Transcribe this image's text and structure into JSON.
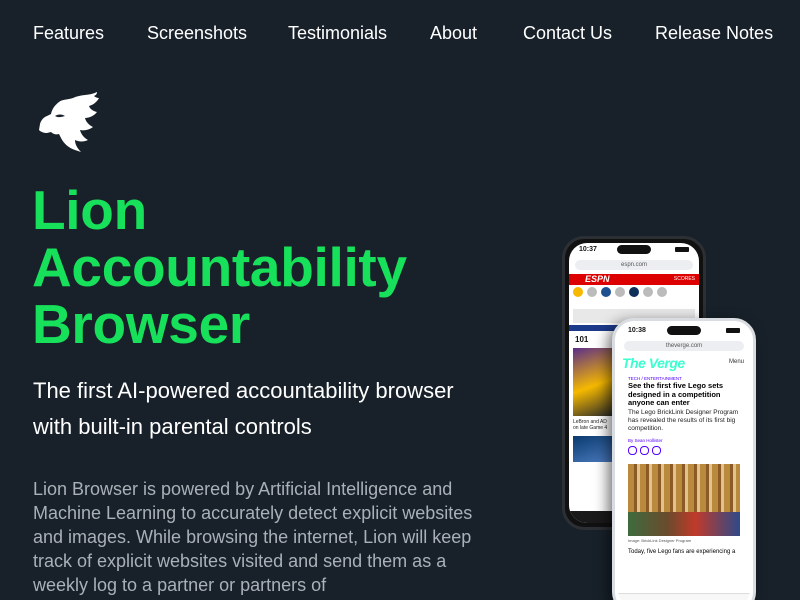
{
  "nav": {
    "items": [
      {
        "label": "Features"
      },
      {
        "label": "Screenshots"
      },
      {
        "label": "Testimonials"
      },
      {
        "label": "About"
      },
      {
        "label": "Contact Us"
      },
      {
        "label": "Release Notes"
      }
    ]
  },
  "logo": {
    "icon": "lion-head-logo",
    "color": "#ffffff"
  },
  "hero": {
    "title_lines": [
      "Lion",
      "Accountability",
      "Browser"
    ],
    "title_color": "#17e15a",
    "subtitle": "The first AI-powered accountability browser with built-in parental controls",
    "body": "Lion Browser is powered by Artificial Intelligence and Machine Learning to accurately detect explicit websites and images. While browsing the internet, Lion will keep track of explicit websites visited and send them as a weekly log to a partner or partners of"
  },
  "phones": {
    "back": {
      "time": "10:37",
      "url": "espn.com",
      "brand": "ESPN",
      "score_label": "SCORES",
      "score_value": "101",
      "caption": "LeBron and AD on late Game 4"
    },
    "front": {
      "time": "10:38",
      "url": "theverge.com",
      "brand": "The Verge",
      "menu": "Menu",
      "tag": "TECH / ENTERTAINMENT",
      "headline": "See the first five Lego sets designed in a competition anyone can enter",
      "dek": "The Lego BrickLink Designer Program has revealed the results of its first big competition.",
      "byline": "By Sean Hollister",
      "image_caption": "Image: BrickLink Designer Program",
      "footer_text": "Today, five Lego fans are experiencing a"
    }
  },
  "colors": {
    "background": "#18212a",
    "accent": "#17e15a",
    "body_text": "#a9b0b7"
  }
}
